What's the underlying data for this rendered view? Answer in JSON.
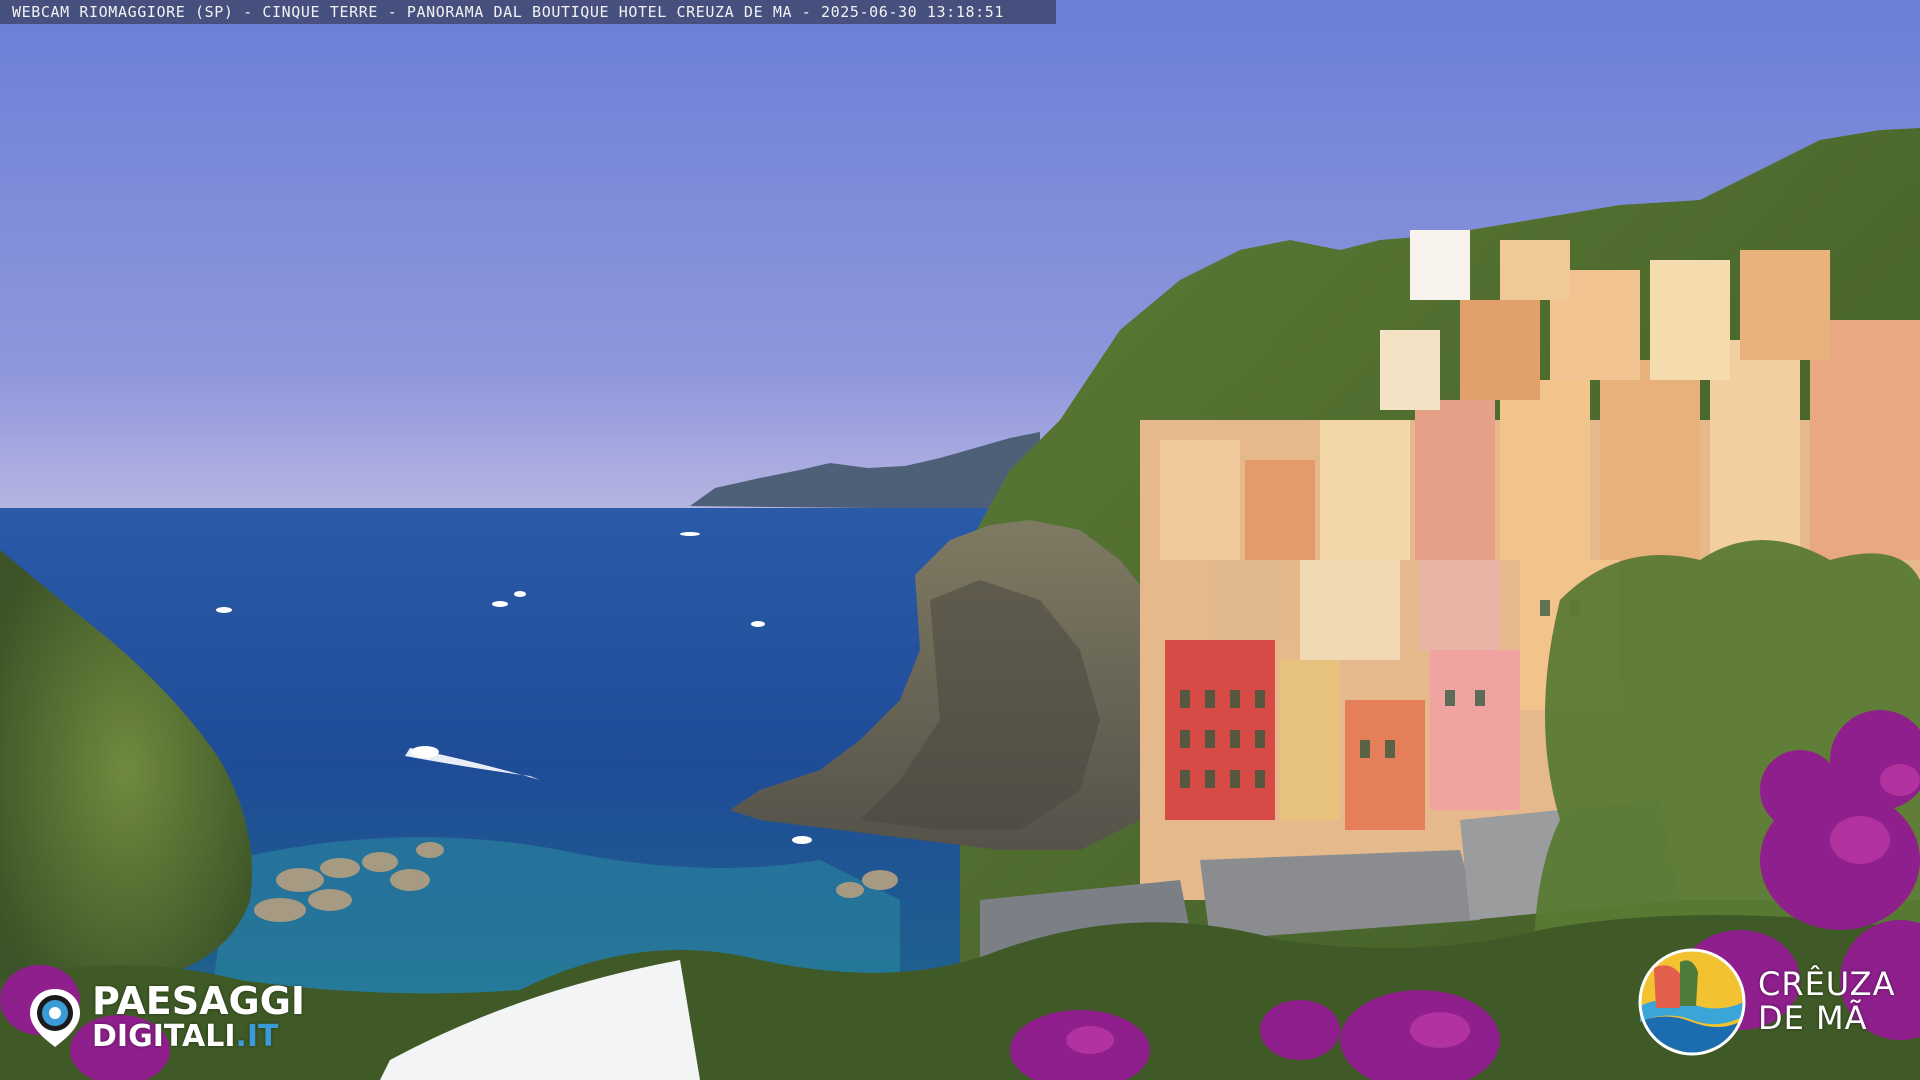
{
  "overlay": {
    "caption": "WEBCAM RIOMAGGIORE (SP) - CINQUE TERRE - PANORAMA DAL BOUTIQUE HOTEL CREUZA DE MA - 2025-06-30 13:18:51"
  },
  "logo_left": {
    "line1": "PAESAGGI",
    "line2_word": "DIGITALI",
    "line2_suffix": ".IT",
    "icon": "eye-logo-icon"
  },
  "logo_right": {
    "line1": "CRÊUZA",
    "line2": "DE MÃ",
    "icon": "creuza-emblem-icon"
  },
  "colors": {
    "sky_top": "#6b7fd6",
    "sky_horizon": "#b3b6e4",
    "sea_deep": "#1f4f9a",
    "sea_shallow": "#2f86a6",
    "hill_green": "#4f6b2f",
    "rock": "#6a6a5e",
    "bougainvillea": "#8e1f8c",
    "accent_blue": "#3a9bd6"
  }
}
